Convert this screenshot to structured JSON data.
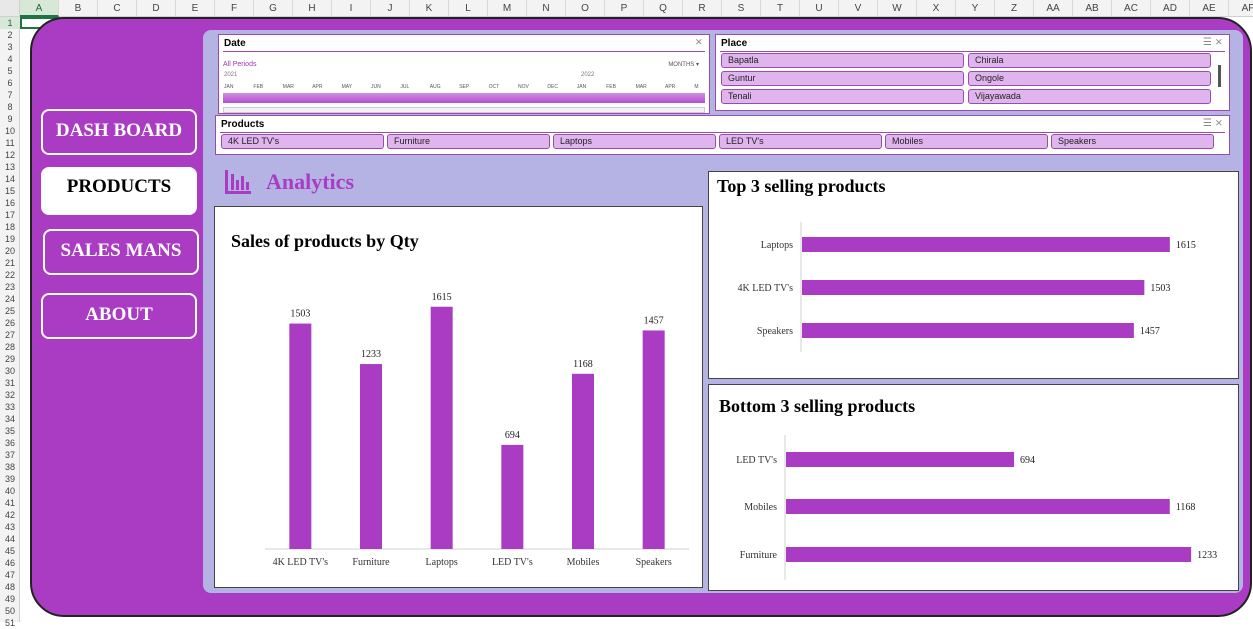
{
  "sheet": {
    "columns": [
      "A",
      "B",
      "C",
      "D",
      "E",
      "F",
      "G",
      "H",
      "I",
      "J",
      "K",
      "L",
      "M",
      "N",
      "O",
      "P",
      "Q",
      "R",
      "S",
      "T",
      "U",
      "V",
      "W",
      "X",
      "Y",
      "Z",
      "AA",
      "AB",
      "AC",
      "AD",
      "AE",
      "AF"
    ],
    "rows": [
      "1",
      "2",
      "3",
      "4",
      "5",
      "6",
      "7",
      "8",
      "9",
      "10",
      "11",
      "12",
      "13",
      "14",
      "15",
      "16",
      "17",
      "18",
      "19",
      "20",
      "21",
      "22",
      "23",
      "24",
      "25",
      "26",
      "27",
      "28",
      "29",
      "30",
      "31",
      "32",
      "33",
      "34",
      "35",
      "36",
      "37",
      "38",
      "39",
      "40",
      "41",
      "42",
      "43",
      "44",
      "45",
      "46",
      "47",
      "48",
      "49",
      "50",
      "51"
    ]
  },
  "nav": {
    "dashboard": "DASH BOARD",
    "products": "PRODUCTS",
    "salesmans": "SALES MANS",
    "about": "ABOUT"
  },
  "date_slicer": {
    "title": "Date",
    "all_periods": "All Periods",
    "granularity": "MONTHS",
    "year1": "2021",
    "year2": "2022",
    "months": [
      "JAN",
      "FEB",
      "MAR",
      "APR",
      "MAY",
      "JUN",
      "JUL",
      "AUG",
      "SEP",
      "OCT",
      "NOV",
      "DEC",
      "JAN",
      "FEB",
      "MAR",
      "APR",
      "M"
    ]
  },
  "place_slicer": {
    "title": "Place",
    "items": [
      "Bapatla",
      "Chirala",
      "Guntur",
      "Ongole",
      "Tenali",
      "Vijayawada"
    ]
  },
  "products_slicer": {
    "title": "Products",
    "items": [
      "4K LED TV's",
      "Furniture",
      "Laptops",
      "LED TV's",
      "Mobiles",
      "Speakers"
    ]
  },
  "analytics": {
    "title": "Analytics"
  },
  "colors": {
    "accent": "#aa3cc4",
    "panel": "#b5b3e4"
  },
  "chart_data": [
    {
      "type": "bar",
      "title": "Sales of products by Qty",
      "categories": [
        "4K LED TV's",
        "Furniture",
        "Laptops",
        "LED TV's",
        "Mobiles",
        "Speakers"
      ],
      "values": [
        1503,
        1233,
        1615,
        694,
        1168,
        1457
      ],
      "ylim": [
        0,
        1800
      ]
    },
    {
      "type": "bar",
      "orientation": "horizontal",
      "title": "Top 3 selling products",
      "categories": [
        "Laptops",
        "4K LED TV's",
        "Speakers"
      ],
      "values": [
        1615,
        1503,
        1457
      ],
      "xlim": [
        0,
        1800
      ]
    },
    {
      "type": "bar",
      "orientation": "horizontal",
      "title": "Bottom 3 selling products",
      "categories": [
        "LED TV's",
        "Mobiles",
        "Furniture"
      ],
      "values": [
        694,
        1168,
        1233
      ],
      "xlim": [
        0,
        1400
      ]
    }
  ]
}
